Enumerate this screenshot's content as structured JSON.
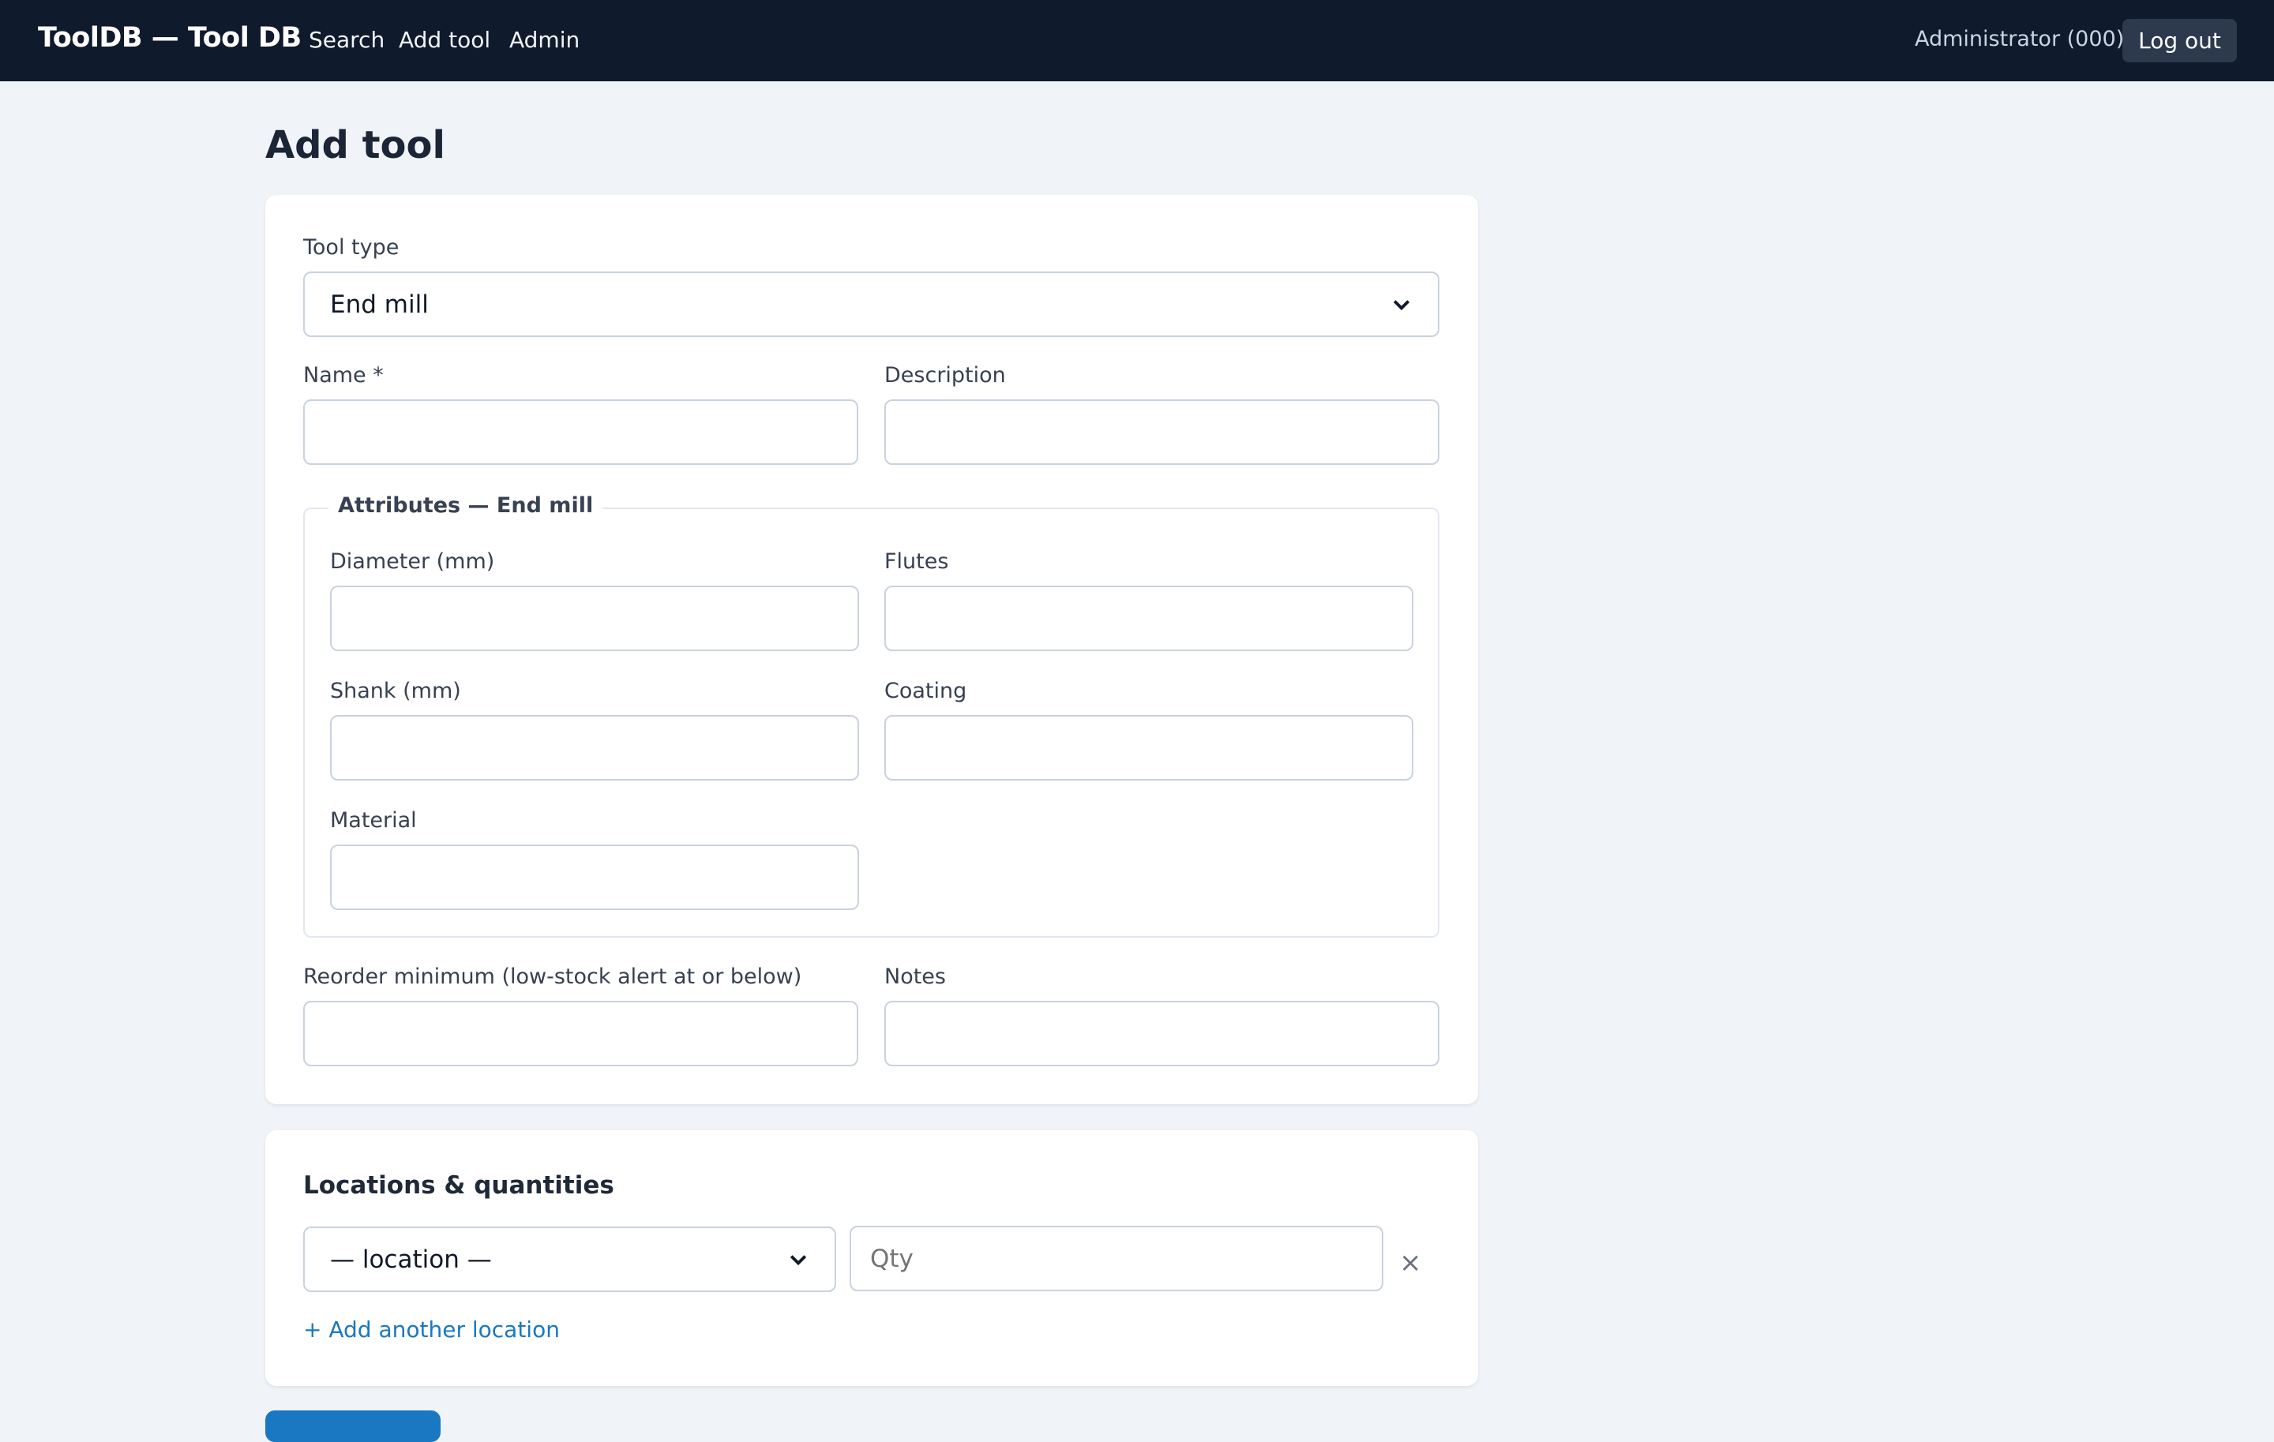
{
  "nav": {
    "brand": "ToolDB — Tool DB",
    "links": [
      "Search",
      "Add tool",
      "Admin"
    ],
    "user": "Administrator (000)",
    "logout": "Log out"
  },
  "page": {
    "title": "Add tool"
  },
  "form": {
    "tool_type": {
      "label": "Tool type",
      "value": "End mill"
    },
    "name": {
      "label": "Name *",
      "value": ""
    },
    "description": {
      "label": "Description",
      "value": ""
    },
    "attributes": {
      "legend": "Attributes — End mill",
      "diameter": {
        "label": "Diameter (mm)",
        "value": ""
      },
      "flutes": {
        "label": "Flutes",
        "value": ""
      },
      "shank": {
        "label": "Shank (mm)",
        "value": ""
      },
      "coating": {
        "label": "Coating",
        "value": ""
      },
      "material": {
        "label": "Material",
        "value": ""
      }
    },
    "reorder_min": {
      "label": "Reorder minimum (low-stock alert at or below)",
      "value": ""
    },
    "notes": {
      "label": "Notes",
      "value": ""
    }
  },
  "locations": {
    "title": "Locations & quantities",
    "location_select": "— location —",
    "qty_placeholder": "Qty",
    "remove_symbol": "×",
    "add_link": "+ Add another location"
  },
  "colors": {
    "topbar": "#0f1a2c",
    "page_bg": "#f0f4f9",
    "accent": "#1a78c2",
    "logout_bg": "#2d3a4d"
  }
}
